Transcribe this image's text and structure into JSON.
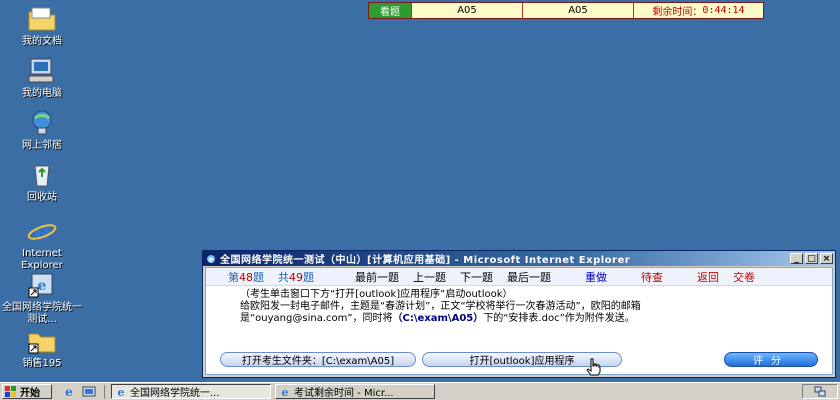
{
  "desktop": {
    "icons": [
      {
        "label": "我的文档"
      },
      {
        "label": "我的电脑"
      },
      {
        "label": "网上邻居"
      },
      {
        "label": "回收站"
      },
      {
        "label": "Internet Explorer"
      },
      {
        "label": "全国网络学院统一测试..."
      },
      {
        "label": "销售195"
      }
    ]
  },
  "status_bar": {
    "view_tab": "看题",
    "cell_a": "A05",
    "cell_b": "A05",
    "time_label": "剩余时间：",
    "time_value": "0:44:14"
  },
  "window": {
    "title": "全国网络学院统一测试（中山）[计算机应用基础] - Microsoft Internet Explorer",
    "nav": {
      "current_prefix": "第",
      "current_num": "48",
      "current_suffix": "题",
      "total_prefix": "共",
      "total_num": "49",
      "total_suffix": "题",
      "first": "最前一题",
      "prev": "上一题",
      "next": "下一题",
      "last": "最后一题",
      "redo": "重做",
      "review": "待查",
      "back": "返回",
      "submit": "交卷"
    },
    "question": {
      "line1": "（考生单击窗口下方“打开[outlook]应用程序”启动outlook）",
      "line2": "给欧阳发一封电子邮件，主题是“春游计划”，正文“学校将举行一次春游活动”，欧阳的邮箱",
      "line3_a": "是“ouyang@sina.com”，同时将",
      "line3_path": "（C:\\exam\\A05）",
      "line3_b": "下的“安排表.doc”作为附件发送。"
    },
    "buttons": {
      "open_folder": "打开考生文件夹：[C:\\exam\\A05]",
      "open_outlook": "打开[outlook]应用程序",
      "score": "评分"
    }
  },
  "taskbar": {
    "start": "开始",
    "task1": "全国网络学院统一...",
    "task2": "考试剩余时间 - Micr..."
  }
}
